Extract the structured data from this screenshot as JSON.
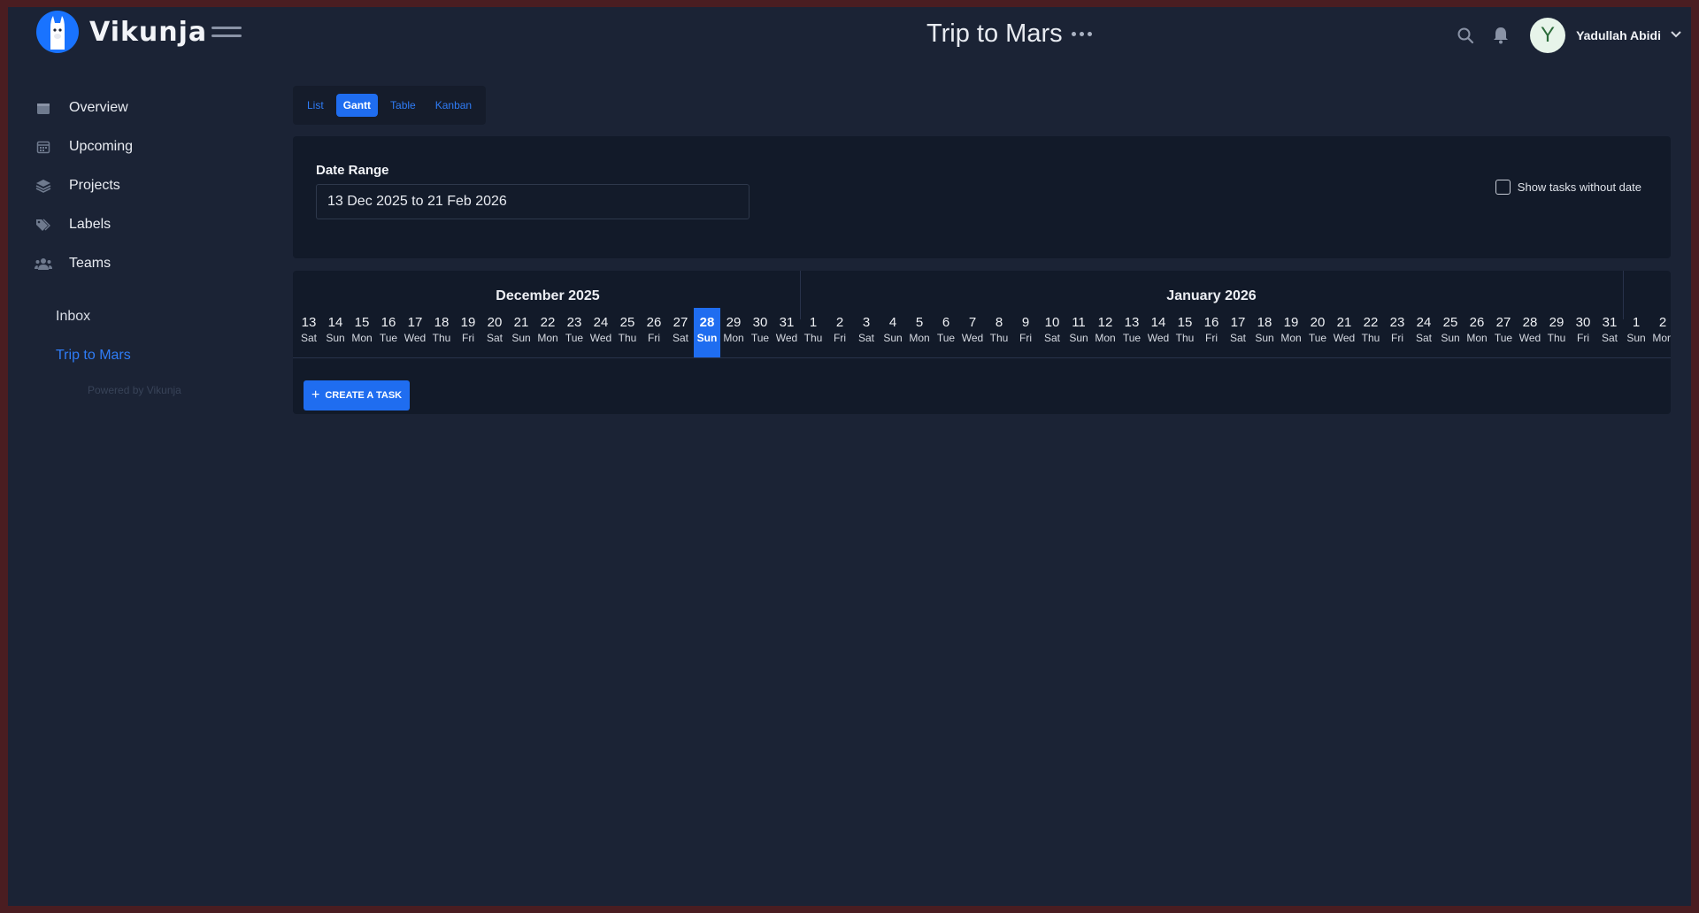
{
  "app": {
    "name": "Vikunja"
  },
  "header": {
    "project_title": "Trip to Mars",
    "user_initial": "Y",
    "user_name": "Yadullah Abidi"
  },
  "sidebar": {
    "nav": [
      {
        "label": "Overview",
        "icon": "calendar-icon"
      },
      {
        "label": "Upcoming",
        "icon": "calendar-grid-icon"
      },
      {
        "label": "Projects",
        "icon": "layers-icon"
      },
      {
        "label": "Labels",
        "icon": "tags-icon"
      },
      {
        "label": "Teams",
        "icon": "users-icon"
      }
    ],
    "projects": [
      "Inbox",
      "Trip to Mars"
    ],
    "active_project": "Trip to Mars",
    "powered_by": "Powered by Vikunja"
  },
  "view_tabs": [
    {
      "label": "List",
      "active": false
    },
    {
      "label": "Gantt",
      "active": true
    },
    {
      "label": "Table",
      "active": false
    },
    {
      "label": "Kanban",
      "active": false
    }
  ],
  "filters": {
    "date_range_label": "Date Range",
    "date_range_value": "13 Dec 2025 to 21 Feb 2026",
    "show_without_date_label": "Show tasks without date",
    "show_without_date_checked": false
  },
  "gantt": {
    "months": [
      "December 2025",
      "January 2026"
    ],
    "days": [
      {
        "d": "13",
        "w": "Sat"
      },
      {
        "d": "14",
        "w": "Sun"
      },
      {
        "d": "15",
        "w": "Mon"
      },
      {
        "d": "16",
        "w": "Tue"
      },
      {
        "d": "17",
        "w": "Wed"
      },
      {
        "d": "18",
        "w": "Thu"
      },
      {
        "d": "19",
        "w": "Fri"
      },
      {
        "d": "20",
        "w": "Sat"
      },
      {
        "d": "21",
        "w": "Sun"
      },
      {
        "d": "22",
        "w": "Mon"
      },
      {
        "d": "23",
        "w": "Tue"
      },
      {
        "d": "24",
        "w": "Wed"
      },
      {
        "d": "25",
        "w": "Thu"
      },
      {
        "d": "26",
        "w": "Fri"
      },
      {
        "d": "27",
        "w": "Sat"
      },
      {
        "d": "28",
        "w": "Sun",
        "today": true
      },
      {
        "d": "29",
        "w": "Mon"
      },
      {
        "d": "30",
        "w": "Tue"
      },
      {
        "d": "31",
        "w": "Wed"
      },
      {
        "d": "1",
        "w": "Thu"
      },
      {
        "d": "2",
        "w": "Fri"
      },
      {
        "d": "3",
        "w": "Sat"
      },
      {
        "d": "4",
        "w": "Sun"
      },
      {
        "d": "5",
        "w": "Mon"
      },
      {
        "d": "6",
        "w": "Tue"
      },
      {
        "d": "7",
        "w": "Wed"
      },
      {
        "d": "8",
        "w": "Thu"
      },
      {
        "d": "9",
        "w": "Fri"
      },
      {
        "d": "10",
        "w": "Sat"
      },
      {
        "d": "11",
        "w": "Sun"
      },
      {
        "d": "12",
        "w": "Mon"
      },
      {
        "d": "13",
        "w": "Tue"
      },
      {
        "d": "14",
        "w": "Wed"
      },
      {
        "d": "15",
        "w": "Thu"
      },
      {
        "d": "16",
        "w": "Fri"
      },
      {
        "d": "17",
        "w": "Sat"
      },
      {
        "d": "18",
        "w": "Sun"
      },
      {
        "d": "19",
        "w": "Mon"
      },
      {
        "d": "20",
        "w": "Tue"
      },
      {
        "d": "21",
        "w": "Wed"
      },
      {
        "d": "22",
        "w": "Thu"
      },
      {
        "d": "23",
        "w": "Fri"
      },
      {
        "d": "24",
        "w": "Sat"
      },
      {
        "d": "25",
        "w": "Sun"
      },
      {
        "d": "26",
        "w": "Mon"
      },
      {
        "d": "27",
        "w": "Tue"
      },
      {
        "d": "28",
        "w": "Wed"
      },
      {
        "d": "29",
        "w": "Thu"
      },
      {
        "d": "30",
        "w": "Fri"
      },
      {
        "d": "31",
        "w": "Sat"
      },
      {
        "d": "1",
        "w": "Sun"
      },
      {
        "d": "2",
        "w": "Mon"
      }
    ],
    "create_task_label": "CREATE A TASK"
  },
  "colors": {
    "accent": "#1f6df0",
    "background": "#1b2335",
    "card": "#121a29"
  }
}
